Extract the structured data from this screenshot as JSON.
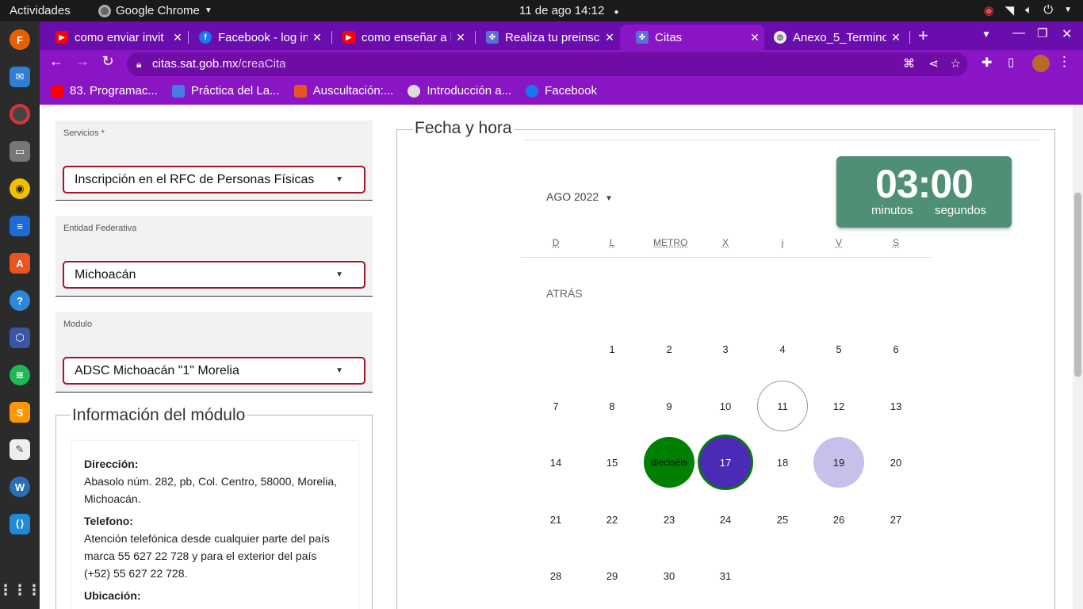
{
  "system": {
    "activities": "Actividades",
    "app_name": "Google Chrome",
    "clock": "11 de ago  14:12"
  },
  "tabs": [
    {
      "label": "como enviar invit",
      "icon": "youtube-icon"
    },
    {
      "label": "Facebook - log in",
      "icon": "facebook-icon"
    },
    {
      "label": "como enseñar a l",
      "icon": "youtube-icon"
    },
    {
      "label": "Realiza tu preinsc",
      "icon": "sat-icon"
    },
    {
      "label": "Citas",
      "icon": "sat-icon"
    },
    {
      "label": "Anexo_5_Termino",
      "icon": "globe-icon"
    }
  ],
  "omnibox": {
    "host": "citas.sat.gob.mx",
    "path": "/creaCita"
  },
  "bookmarks": [
    {
      "label": "83. Programac...",
      "icon": "youtube-icon"
    },
    {
      "label": "Práctica del La...",
      "icon": "docs-icon"
    },
    {
      "label": "Auscultación:...",
      "icon": "app-icon"
    },
    {
      "label": "Introducción a...",
      "icon": "globe-icon"
    },
    {
      "label": "Facebook",
      "icon": "facebook-icon"
    }
  ],
  "form": {
    "servicios": {
      "label": "Servicios *",
      "value": "Inscripción en el RFC de Personas Físicas"
    },
    "entidad": {
      "label": "Entidad Federativa",
      "value": "Michoacán"
    },
    "modulo": {
      "label": "Modulo",
      "value": "ADSC Michoacán \"1\" Morelia"
    }
  },
  "info": {
    "title": "Información del módulo",
    "direccion_label": "Dirección:",
    "direccion": "Abasolo núm. 282, pb, Col. Centro, 58000, Morelia, Michoacán.",
    "telefono_label": "Telefono:",
    "telefono": "Atención telefónica desde cualquier parte del país marca 55 627 22 728 y para el exterior del país (+52) 55 627 22 728.",
    "ubicacion_label": "Ubicación:"
  },
  "calendar": {
    "title": "Fecha y hora",
    "month": "AGO 2022",
    "back": "ATRÁS",
    "weekdays": [
      "D",
      "L",
      "METRO",
      "X",
      "j",
      "V",
      "S"
    ],
    "weeks": [
      [
        "",
        "1",
        "2",
        "3",
        "4",
        "5",
        "6"
      ],
      [
        "7",
        "8",
        "9",
        "10",
        "11",
        "12",
        "13"
      ],
      [
        "14",
        "15",
        "dieciséis",
        "17",
        "18",
        "19",
        "20"
      ],
      [
        "21",
        "22",
        "23",
        "24",
        "25",
        "26",
        "27"
      ],
      [
        "28",
        "29",
        "30",
        "31",
        "",
        "",
        ""
      ]
    ],
    "today": "11",
    "selected": "17",
    "highlight_green": "dieciséis",
    "available": [
      "19"
    ]
  },
  "timer": {
    "time": "03:00",
    "unit_min": "minutos",
    "unit_sec": "segundos"
  },
  "colors": {
    "chrome_purple": "#8a15c4",
    "timer_green": "#4f8f73",
    "select_border": "#a0162f",
    "selected_day": "#4b2bb5"
  }
}
